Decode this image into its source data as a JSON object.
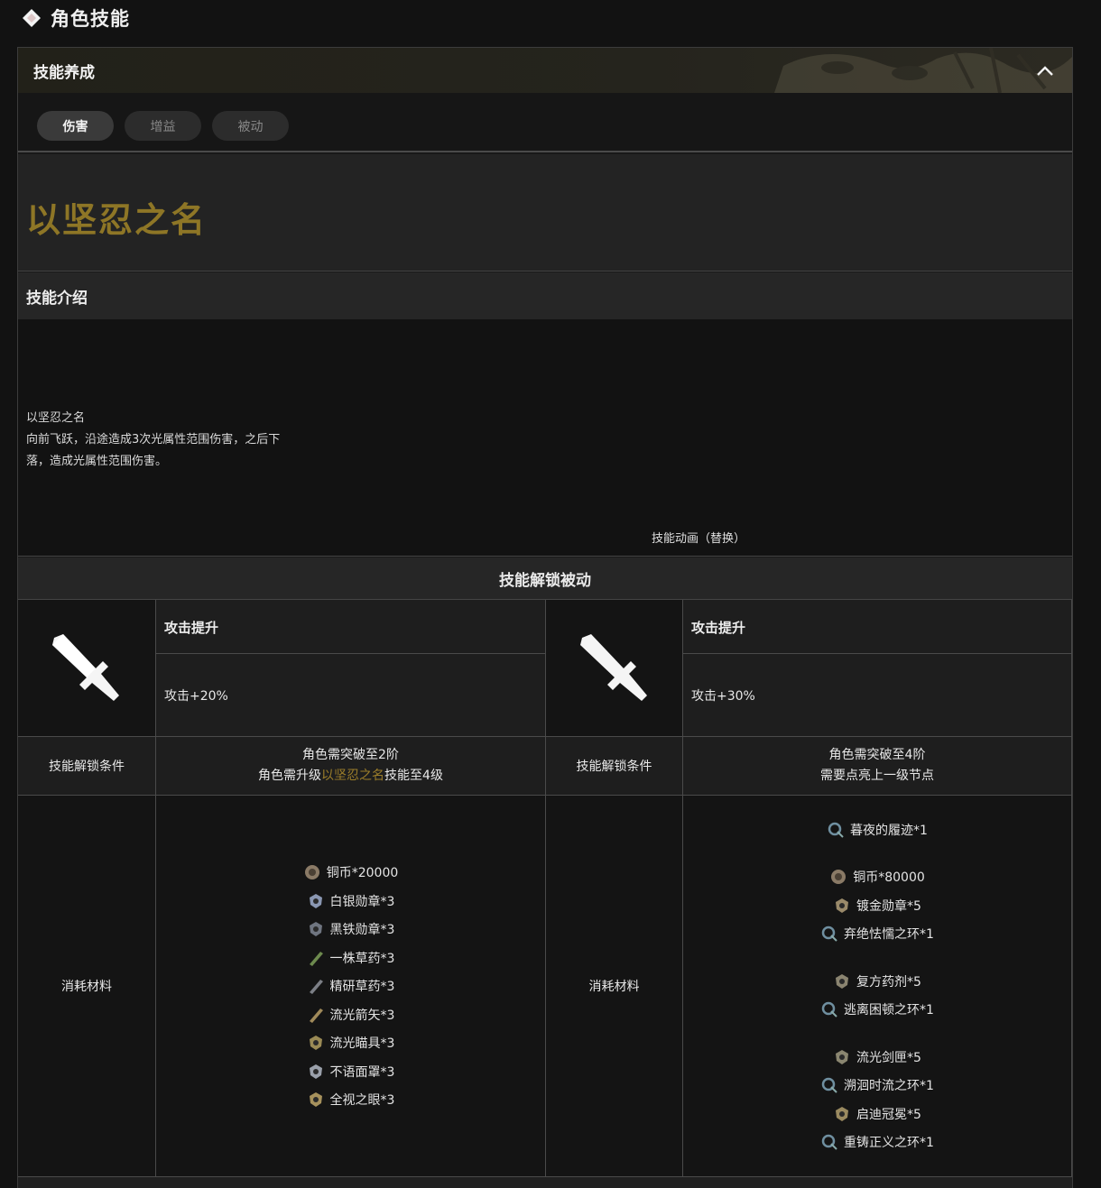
{
  "section": {
    "title": "角色技能",
    "icon": "diamond-icon"
  },
  "panel": {
    "title": "技能养成",
    "collapse_icon": "chevron-up-icon"
  },
  "tabs": [
    {
      "label": "伤害",
      "active": true
    },
    {
      "label": "增益",
      "active": false
    },
    {
      "label": "被动",
      "active": false
    }
  ],
  "skill": {
    "name": "以坚忍之名",
    "intro_header": "技能介绍",
    "intro_lines": [
      "以坚忍之名",
      "向前飞跃，沿途造成3次光属性范围伤害，之后下",
      "落，造成光属性范围伤害。"
    ],
    "animation_label": "技能动画（替换）"
  },
  "unlock": {
    "title": "技能解锁被动",
    "passives": [
      {
        "icon": "sword-icon",
        "name": "攻击提升",
        "effect": "攻击+20%",
        "condition_label": "技能解锁条件",
        "condition_lines": [
          {
            "pre": "角色需突破至2阶",
            "hl": "",
            "post": ""
          },
          {
            "pre": "角色需升级",
            "hl": "以坚忍之名",
            "post": "技能至4级"
          }
        ],
        "materials_label": "消耗材料",
        "materials": [
          {
            "icon": "copper-coin-icon",
            "text": "铜币*20000"
          },
          {
            "icon": "silver-medal-icon",
            "text": "白银勋章*3"
          },
          {
            "icon": "iron-medal-icon",
            "text": "黑铁勋章*3"
          },
          {
            "icon": "herb-icon",
            "text": "一株草药*3"
          },
          {
            "icon": "refined-herb-icon",
            "text": "精研草药*3"
          },
          {
            "icon": "arrow-icon",
            "text": "流光箭矢*3"
          },
          {
            "icon": "scope-icon",
            "text": "流光瞄具*3"
          },
          {
            "icon": "mask-icon",
            "text": "不语面罩*3"
          },
          {
            "icon": "eye-icon",
            "text": "全视之眼*3"
          }
        ]
      },
      {
        "icon": "sword-icon",
        "name": "攻击提升",
        "effect": "攻击+30%",
        "condition_label": "技能解锁条件",
        "condition_lines": [
          {
            "pre": "角色需突破至4阶",
            "hl": "",
            "post": ""
          },
          {
            "pre": "需要点亮上一级节点",
            "hl": "",
            "post": ""
          }
        ],
        "materials_label": "消耗材料",
        "materials": [
          {
            "icon": "ring-icon",
            "text": "暮夜的履迹*1",
            "gap": false
          },
          {
            "icon": "copper-coin-icon",
            "text": "铜币*80000",
            "gap": true
          },
          {
            "icon": "gold-medal-icon",
            "text": "镀金勋章*5",
            "gap": false
          },
          {
            "icon": "ring-icon",
            "text": "弃绝怯懦之环*1",
            "gap": false
          },
          {
            "icon": "potion-icon",
            "text": "复方药剂*5",
            "gap": true
          },
          {
            "icon": "ring-icon",
            "text": "逃离困顿之环*1",
            "gap": false
          },
          {
            "icon": "sword-box-icon",
            "text": "流光剑匣*5",
            "gap": true
          },
          {
            "icon": "ring-icon",
            "text": "溯洄时流之环*1",
            "gap": false
          },
          {
            "icon": "crown-icon",
            "text": "启迪冠冕*5",
            "gap": false
          },
          {
            "icon": "ring-icon",
            "text": "重铸正义之环*1",
            "gap": false
          }
        ]
      }
    ]
  },
  "colors": {
    "accent_gold": "#8e7626",
    "highlight": "#9c7e2a",
    "background": "#121212"
  }
}
